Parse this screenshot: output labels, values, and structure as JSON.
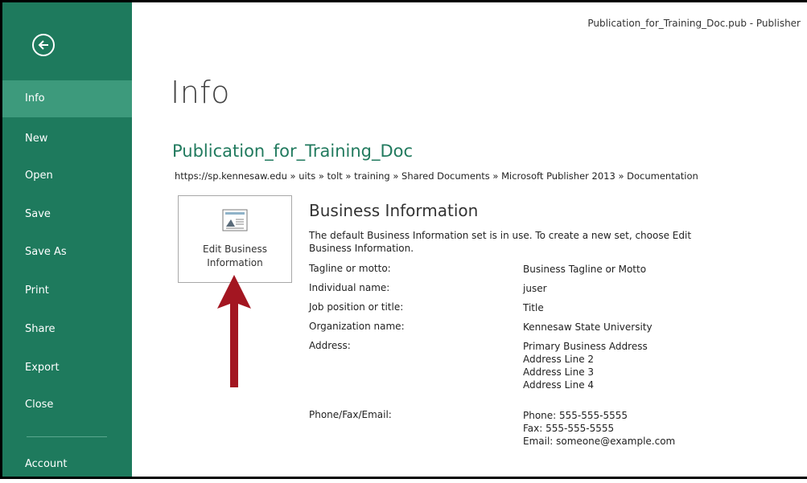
{
  "window": {
    "title": "Publication_for_Training_Doc.pub - Publisher"
  },
  "sidebar": {
    "back_icon": "back-arrow-circle-icon",
    "accent_color": "#1e7a5d",
    "active_color": "#3d9a7c",
    "items": [
      {
        "label": "Info",
        "active": true
      },
      {
        "label": "New"
      },
      {
        "label": "Open"
      },
      {
        "label": "Save"
      },
      {
        "label": "Save As"
      },
      {
        "label": "Print"
      },
      {
        "label": "Share"
      },
      {
        "label": "Export"
      },
      {
        "label": "Close"
      },
      {
        "label": "Account"
      }
    ]
  },
  "main": {
    "page_title": "Info",
    "doc_title": "Publication_for_Training_Doc",
    "breadcrumb": "https://sp.kennesaw.edu » uits » tolt » training » Shared Documents » Microsoft Publisher 2013 » Documentation",
    "edit_button": {
      "icon": "business-card-icon",
      "line1": "Edit Business",
      "line2": "Information"
    },
    "annotation_arrow_color": "#a31621",
    "business_info": {
      "title": "Business Information",
      "description_line1": "The default Business Information set is in use. To create a new set, choose Edit",
      "description_line2": "Business Information.",
      "rows": [
        {
          "label": "Tagline or motto:",
          "values": [
            "Business Tagline or Motto"
          ]
        },
        {
          "label": "Individual name:",
          "values": [
            "juser"
          ]
        },
        {
          "label": "Job position or title:",
          "values": [
            "Title"
          ]
        },
        {
          "label": "Organization name:",
          "values": [
            "Kennesaw State University"
          ]
        },
        {
          "label": "Address:",
          "values": [
            "Primary Business Address",
            "Address Line 2",
            "Address Line 3",
            "Address Line 4"
          ]
        },
        {
          "label": "Phone/Fax/Email:",
          "values": [
            "Phone: 555-555-5555",
            "Fax: 555-555-5555",
            "Email: someone@example.com"
          ]
        }
      ]
    }
  }
}
